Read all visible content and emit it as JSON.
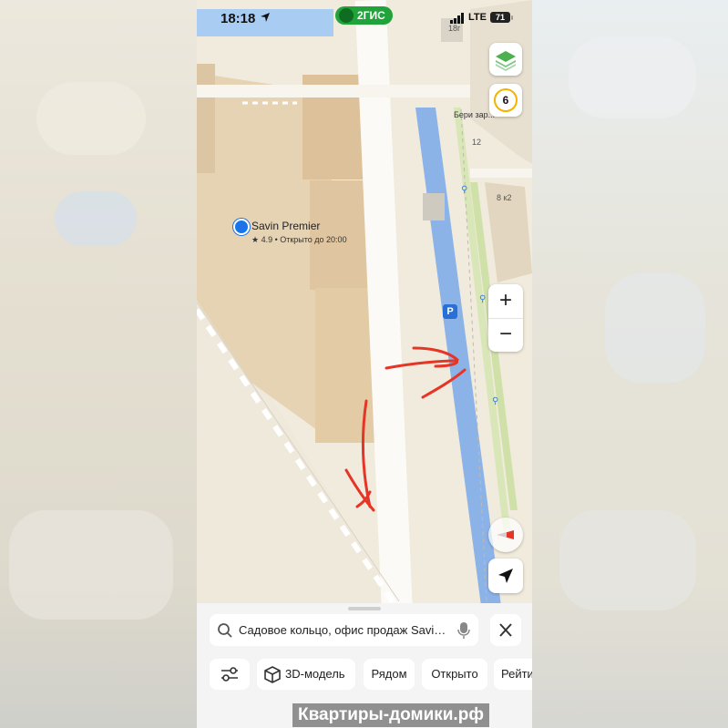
{
  "status_bar": {
    "time": "18:18",
    "brand": "2ГИС",
    "network": "LTE",
    "battery": "71"
  },
  "map": {
    "poi": {
      "name": "Savin Premier",
      "meta": "★ 4.9 • Открыто до 20:00"
    },
    "labels": {
      "building_a": "18г",
      "building_b": "8 к2",
      "bike": "Бери зар...",
      "num": "12"
    },
    "traffic_level": "6",
    "parking": "P"
  },
  "controls": {
    "zoom_in": "+",
    "zoom_out": "−"
  },
  "search": {
    "query": "Садовое кольцо, офис продаж Savin Premier"
  },
  "chips": [
    "3D-модель",
    "Рядом",
    "Открыто",
    "Рейтинг"
  ],
  "watermark": "Квартиры-домики.рф",
  "colors": {
    "brand": "#20a33a",
    "annotation": "#e53526",
    "route": "#8cb3e8"
  }
}
